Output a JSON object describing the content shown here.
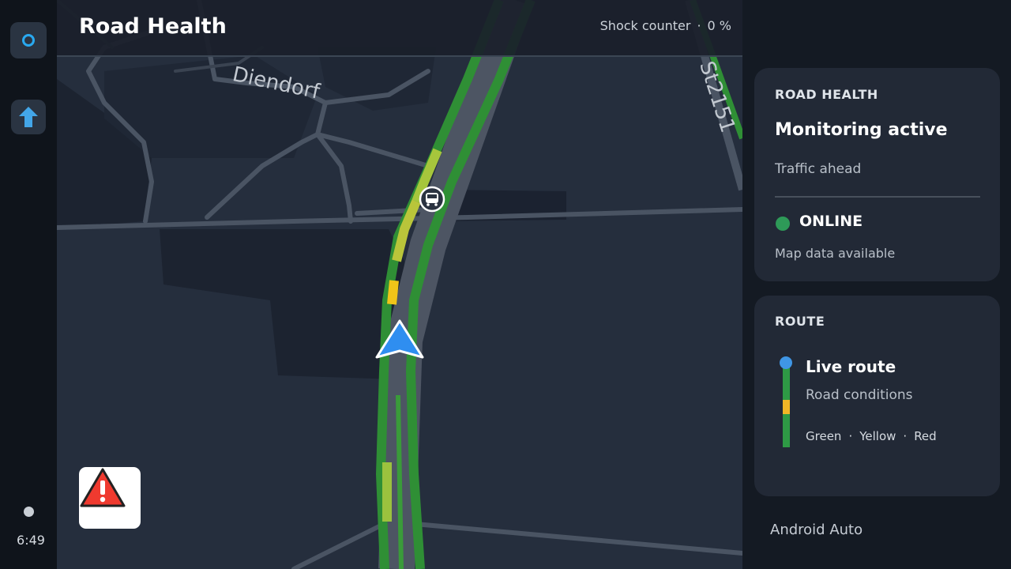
{
  "rail": {
    "time": "6:49",
    "top_button_icon": "circle-icon",
    "nav_button_icon": "arrow-up-icon"
  },
  "map": {
    "title": "Road Health",
    "shock_counter_label": "Shock counter",
    "shock_counter_separator": "·",
    "shock_counter_value": "0 %",
    "place_label": "Diendorf",
    "road_label": "St2151",
    "alert_icon": "warning-triangle-icon",
    "bus_icon": "bus-stop-icon"
  },
  "health_card": {
    "label": "ROAD HEALTH",
    "status": "Monitoring active",
    "subtitle": "Traffic ahead",
    "connection": "ONLINE",
    "connection_color": "#2e9a58",
    "map_data": "Map data available"
  },
  "route_card": {
    "label": "ROUTE",
    "title": "Live route",
    "subtitle": "Road conditions",
    "legend": [
      "Green",
      "Yellow",
      "Red"
    ],
    "legend_separator": "·",
    "colors": {
      "green": "#2e9a45",
      "yellow": "#f1b626",
      "dot": "#3f96e5"
    }
  },
  "footer": {
    "app_name": "Android Auto"
  }
}
